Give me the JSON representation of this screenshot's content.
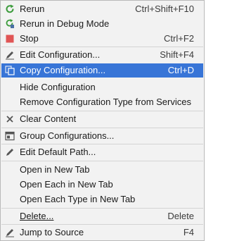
{
  "menu": {
    "items": [
      {
        "label": "Rerun",
        "shortcut": "Ctrl+Shift+F10",
        "icon": "rerun-icon"
      },
      {
        "label": "Rerun in Debug Mode",
        "shortcut": "",
        "icon": "rerun-debug-icon"
      },
      {
        "label": "Stop",
        "shortcut": "Ctrl+F2",
        "icon": "stop-icon"
      },
      {
        "label": "Edit Configuration...",
        "shortcut": "Shift+F4",
        "icon": "pencil-icon"
      },
      {
        "label": "Copy Configuration...",
        "shortcut": "Ctrl+D",
        "icon": "copy-icon"
      },
      {
        "label": "Hide Configuration",
        "shortcut": "",
        "icon": ""
      },
      {
        "label": "Remove Configuration Type from Services",
        "shortcut": "",
        "icon": ""
      },
      {
        "label": "Clear Content",
        "shortcut": "",
        "icon": "close-icon"
      },
      {
        "label": "Group Configurations...",
        "shortcut": "",
        "icon": "group-icon"
      },
      {
        "label": "Edit Default Path...",
        "shortcut": "",
        "icon": "pencil-icon"
      },
      {
        "label": "Open in New Tab",
        "shortcut": "",
        "icon": ""
      },
      {
        "label": "Open Each in New Tab",
        "shortcut": "",
        "icon": ""
      },
      {
        "label": "Open Each Type in New Tab",
        "shortcut": "",
        "icon": ""
      },
      {
        "label": "Delete...",
        "shortcut": "Delete",
        "icon": ""
      },
      {
        "label": "Jump to Source",
        "shortcut": "F4",
        "icon": "jump-source-icon"
      }
    ],
    "selected_label": "Copy Configuration..."
  },
  "colors": {
    "menu_background": "#f2f2f2",
    "selection": "#3875d7",
    "rerun_green": "#3b9b3b",
    "stop_red": "#e05555"
  }
}
